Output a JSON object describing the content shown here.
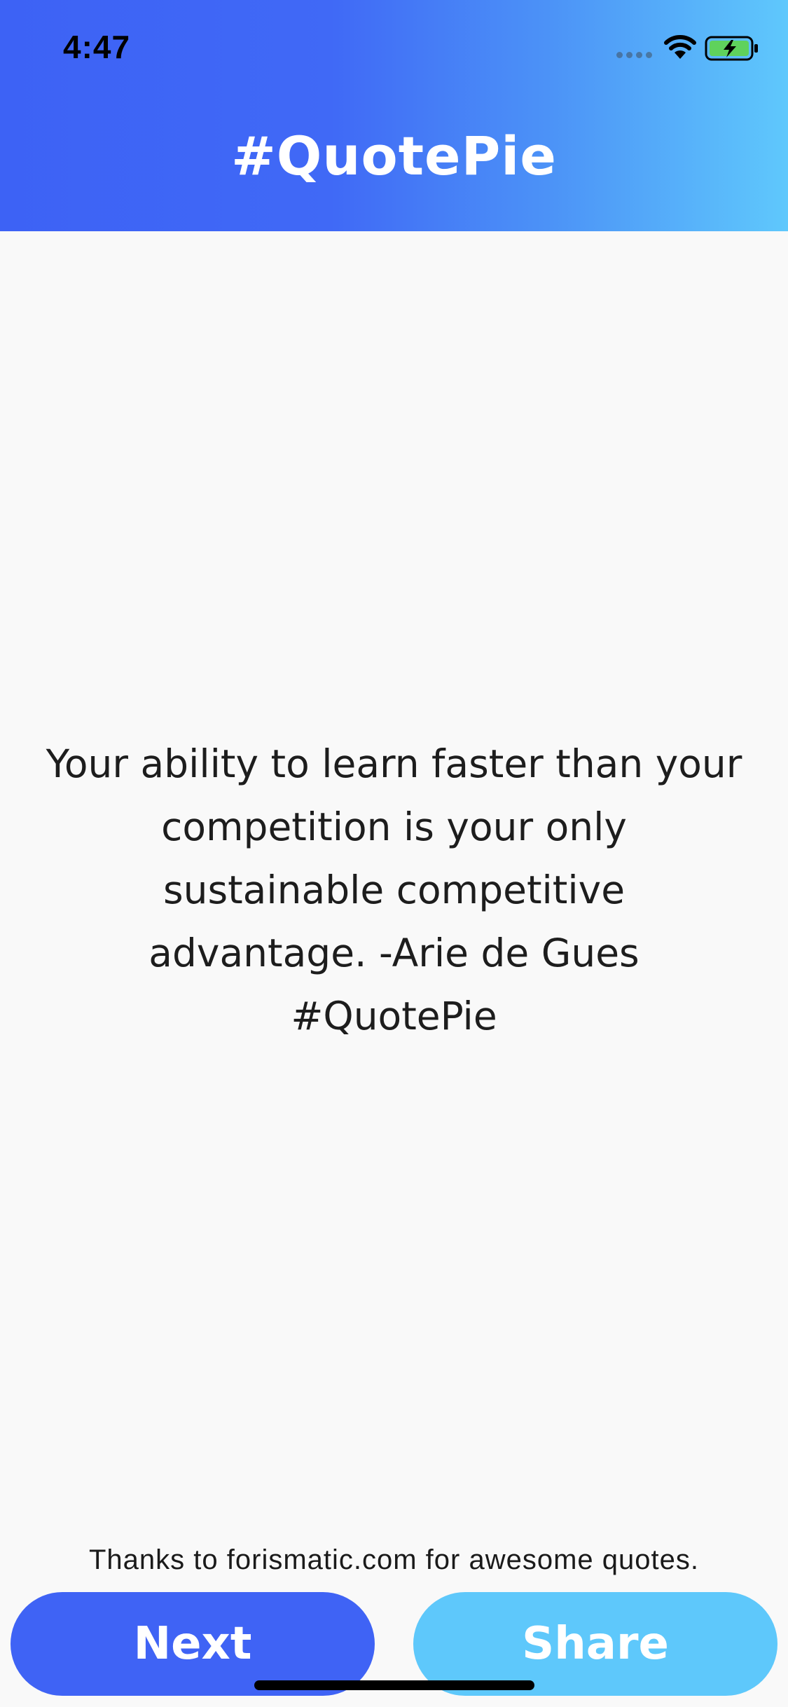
{
  "status_bar": {
    "time": "4:47",
    "signal_icon": "signal-dots-icon",
    "wifi_icon": "wifi-icon",
    "battery_icon": "battery-charging-icon"
  },
  "header": {
    "title": "#QuotePie",
    "gradient_colors": [
      "#3d62f5",
      "#4069f6",
      "#4c93f7",
      "#5fc8fc"
    ]
  },
  "quote": {
    "lines": [
      "Your ability to learn faster than your",
      "competition is your only",
      "sustainable competitive",
      "advantage.  -Arie de Gues",
      "#QuotePie"
    ]
  },
  "footer": {
    "credit": "Thanks to forismatic.com for awesome quotes.",
    "next_label": "Next",
    "share_label": "Share",
    "next_color": "#3f63f5",
    "share_color": "#5ec8fb"
  }
}
